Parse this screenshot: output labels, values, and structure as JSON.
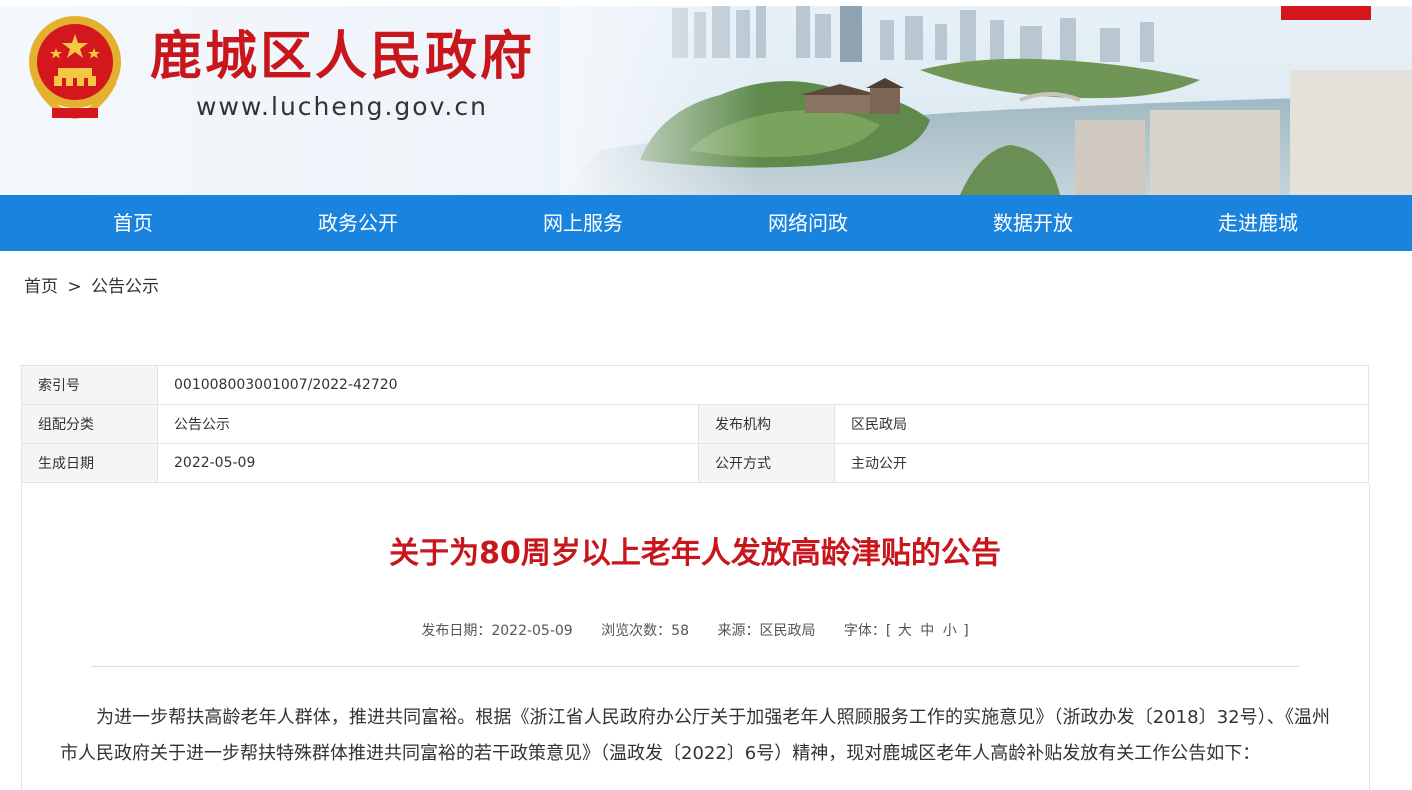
{
  "header": {
    "site_name": "鹿城区人民政府",
    "site_url": "www.lucheng.gov.cn"
  },
  "nav": {
    "items": [
      "首页",
      "政务公开",
      "网上服务",
      "网络问政",
      "数据开放",
      "走进鹿城"
    ]
  },
  "breadcrumb": {
    "home": "首页",
    "separator": ">",
    "current": "公告公示"
  },
  "meta": {
    "index_label": "索引号",
    "index_value": "001008003001007/2022-42720",
    "category_label": "组配分类",
    "category_value": "公告公示",
    "publisher_label": "发布机构",
    "publisher_value": "区民政局",
    "date_label": "生成日期",
    "date_value": "2022-05-09",
    "mode_label": "公开方式",
    "mode_value": "主动公开"
  },
  "article": {
    "title": "关于为80周岁以上老年人发放高龄津贴的公告",
    "publish_date": "发布日期：2022-05-09",
    "views": "浏览次数：58",
    "source": "来源：区民政局",
    "font_label": "字体：[",
    "font_large": "大",
    "font_medium": "中",
    "font_small": "小",
    "font_close": "]",
    "paragraph1": "为进一步帮扶高龄老年人群体，推进共同富裕。根据《浙江省人民政府办公厅关于加强老年人照顾服务工作的实施意见》（浙政办发〔2018〕32号）、《温州市人民政府关于进一步帮扶特殊群体推进共同富裕的若干政策意见》（温政发〔2022〕6号）精神，现对鹿城区老年人高龄补贴发放有关工作公告如下："
  },
  "colors": {
    "brand_red": "#c7161c",
    "nav_blue": "#1a83de"
  }
}
